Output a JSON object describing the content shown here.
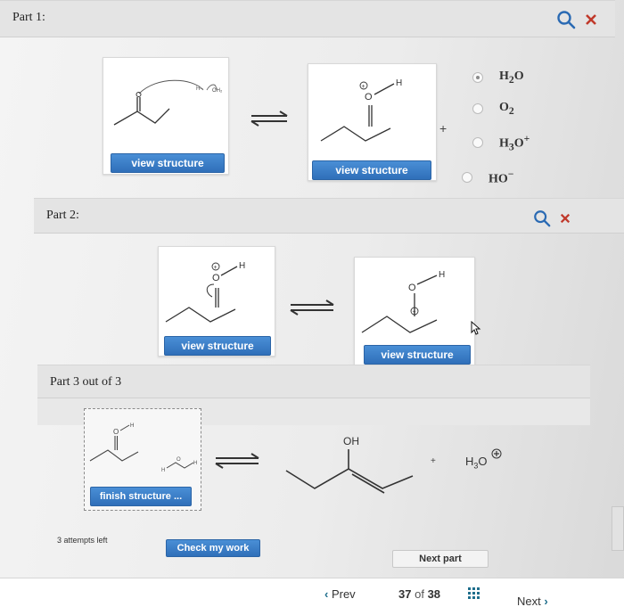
{
  "part1": {
    "title": "Part 1:",
    "view_structure_1": "view structure",
    "view_structure_2": "view structure",
    "plus": "+",
    "options": [
      {
        "label": "H2O",
        "main": "H",
        "sub": "2",
        "tail": "O",
        "sup": "",
        "selected": true
      },
      {
        "label": "O2",
        "main": "O",
        "sub": "2",
        "tail": "",
        "sup": "",
        "selected": false
      },
      {
        "label": "H3O+",
        "main": "H",
        "sub": "3",
        "tail": "O",
        "sup": "+",
        "selected": false
      },
      {
        "label": "HO−",
        "main": "HO",
        "sub": "",
        "tail": "",
        "sup": "−",
        "selected": false
      }
    ]
  },
  "part2": {
    "title": "Part 2:",
    "view_structure_1": "view structure",
    "view_structure_2": "view structure"
  },
  "part3": {
    "title": "Part 3 out of 3",
    "finish_structure": "finish structure ...",
    "oh_label": "OH",
    "plus": "+",
    "h3o_main": "H",
    "h3o_sub": "3",
    "h3o_tail": "O"
  },
  "actions": {
    "attempts_left": "3 attempts left",
    "check_my_work": "Check my work",
    "next_part": "Next part"
  },
  "footer": {
    "prev": "Prev",
    "page_current": "37",
    "page_of": "of",
    "page_total": "38",
    "next": "Next"
  },
  "icons": {
    "search": "search-icon",
    "close": "close-icon",
    "grid": "grid-icon"
  },
  "colors": {
    "accent_blue": "#2f6fb9",
    "icon_blue": "#2a6ab3",
    "close_red": "#c0392b",
    "footer_teal": "#1f6e8c"
  }
}
